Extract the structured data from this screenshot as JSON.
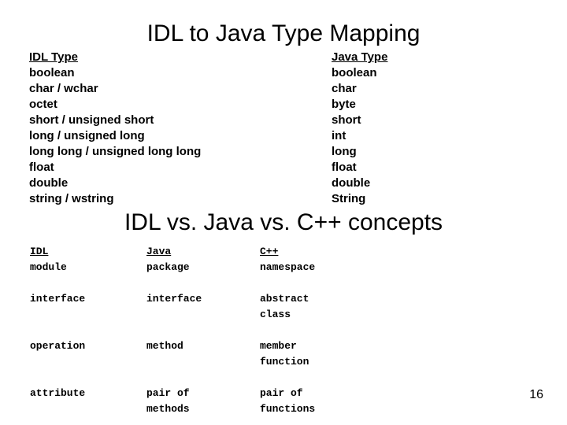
{
  "slide": {
    "page_number": "16",
    "background_color": "#ffffff",
    "text_color": "#000000"
  },
  "type_mapping": {
    "title": "IDL to Java Type Mapping",
    "left_header": "IDL Type",
    "right_header": "Java Type",
    "rows": [
      {
        "idl": "boolean",
        "java": "boolean"
      },
      {
        "idl": "char / wchar",
        "java": "char"
      },
      {
        "idl": "octet",
        "java": "byte"
      },
      {
        "idl": "short / unsigned short",
        "java": "short"
      },
      {
        "idl": "long / unsigned long",
        "java": "int"
      },
      {
        "idl": "long long / unsigned long long",
        "java": "long"
      },
      {
        "idl": "float",
        "java": "float"
      },
      {
        "idl": "double",
        "java": "double"
      },
      {
        "idl": "string / wstring",
        "java": "String"
      }
    ]
  },
  "concepts": {
    "title": "IDL vs. Java vs. C++ concepts",
    "headers": [
      "IDL",
      "Java",
      "C++"
    ],
    "rows": [
      {
        "idl": "module",
        "java": "package",
        "cpp": "namespace"
      },
      {
        "idl": "interface",
        "java": "interface",
        "cpp": "abstract\nclass"
      },
      {
        "idl": "operation",
        "java": "method",
        "cpp": "member\nfunction"
      },
      {
        "idl": "attribute",
        "java": "pair of\nmethods",
        "cpp": "pair of\nfunctions"
      }
    ]
  }
}
